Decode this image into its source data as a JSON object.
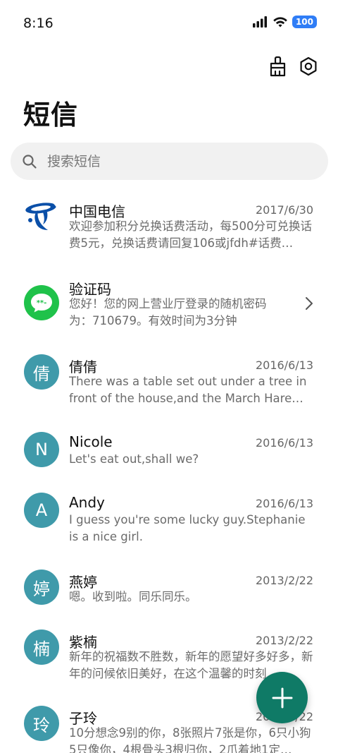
{
  "status_bar": {
    "time": "8:16",
    "battery": "100"
  },
  "toolbar": {
    "clean_icon": "broom-icon",
    "settings_icon": "gear-icon"
  },
  "page": {
    "title": "短信"
  },
  "search": {
    "placeholder": "搜索短信"
  },
  "conversations": [
    {
      "name": "中国电信",
      "date": "2017/6/30",
      "preview": "欢迎参加积分兑换话费活动，每500分可兑换话费5元，兑换话费请回复106或jfdh#话费…",
      "avatar_type": "china-telecom-logo"
    },
    {
      "name": "验证码",
      "date": "",
      "preview": "您好！您的网上营业厅登录的随机密码为：710679。有效时间为3分钟",
      "avatar_type": "message-bubble-icon"
    },
    {
      "name": "倩倩",
      "date": "2016/6/13",
      "preview": "There was a table set out under a tree in front of the house,and the March Hare an…",
      "avatar_letter": "倩"
    },
    {
      "name": "Nicole",
      "date": "2016/6/13",
      "preview": "Let's eat out,shall we?",
      "avatar_letter": "N"
    },
    {
      "name": "Andy",
      "date": "2016/6/13",
      "preview": "I guess you're some lucky guy.Stephanie is a nice girl.",
      "avatar_letter": "A"
    },
    {
      "name": "燕婷",
      "date": "2013/2/22",
      "preview": "嗯。收到啦。同乐同乐。",
      "avatar_letter": "婷"
    },
    {
      "name": "紫楠",
      "date": "2013/2/22",
      "preview": "新年的祝福数不胜数，新年的愿望好多好多，新年的问候依旧美好，在这个温馨的时刻…",
      "avatar_letter": "楠"
    },
    {
      "name": "子玲",
      "date": "2013/2/22",
      "preview": "10分想念9别的你，8张照片7张是你，6只小狗5只像你，4根骨头3根归你，2爪着地1定…",
      "avatar_letter": "玲"
    }
  ],
  "fab": {
    "icon": "plus-icon"
  },
  "colors": {
    "avatar": "#3f9aaa",
    "fab": "#0f7a66",
    "battery": "#2f7df6",
    "search_bg": "#f1f1f1",
    "message_green": "#1fc24a",
    "telecom_blue": "#0a4fa8"
  }
}
